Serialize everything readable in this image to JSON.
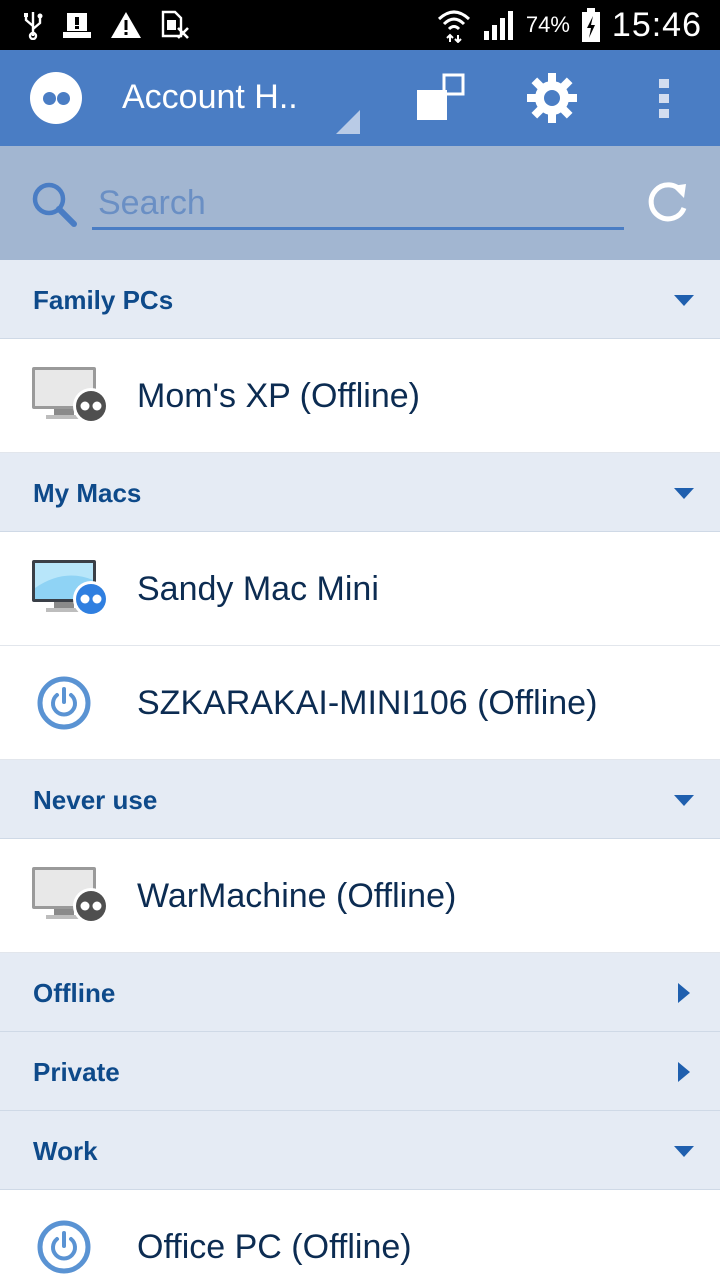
{
  "status_bar": {
    "battery": "74%",
    "time": "15:46",
    "icons_left": [
      "usb-icon",
      "storage-icon",
      "warning-icon",
      "sim-off-icon"
    ],
    "icons_right": [
      "wifi-icon",
      "signal-icon",
      "battery-icon"
    ]
  },
  "app_bar": {
    "title": "Account H..",
    "icons": [
      "logo-icon",
      "resize-icon",
      "settings-gear-icon",
      "overflow-menu-icon"
    ],
    "accent_color": "#4a7dc4"
  },
  "search": {
    "placeholder": "Search",
    "value": ""
  },
  "groups": [
    {
      "label": "Family PCs",
      "expanded": true,
      "items": [
        {
          "label": "Mom's XP (Offline)",
          "icon": "computer-offline-icon"
        }
      ]
    },
    {
      "label": "My Macs",
      "expanded": true,
      "items": [
        {
          "label": "Sandy Mac Mini",
          "icon": "computer-online-icon"
        },
        {
          "label": "SZKARAKAI-MINI106 (Offline)",
          "icon": "power-icon"
        }
      ]
    },
    {
      "label": "Never use",
      "expanded": true,
      "items": [
        {
          "label": "WarMachine (Offline)",
          "icon": "computer-offline-icon"
        }
      ]
    },
    {
      "label": "Offline",
      "expanded": false,
      "items": []
    },
    {
      "label": "Private",
      "expanded": false,
      "items": []
    },
    {
      "label": "Work",
      "expanded": true,
      "items": [
        {
          "label": "Office PC (Offline)",
          "icon": "power-icon"
        }
      ]
    }
  ],
  "colors": {
    "header_bg": "#e5ebf4",
    "header_text": "#0e4a8a",
    "item_text": "#0c2c52"
  }
}
